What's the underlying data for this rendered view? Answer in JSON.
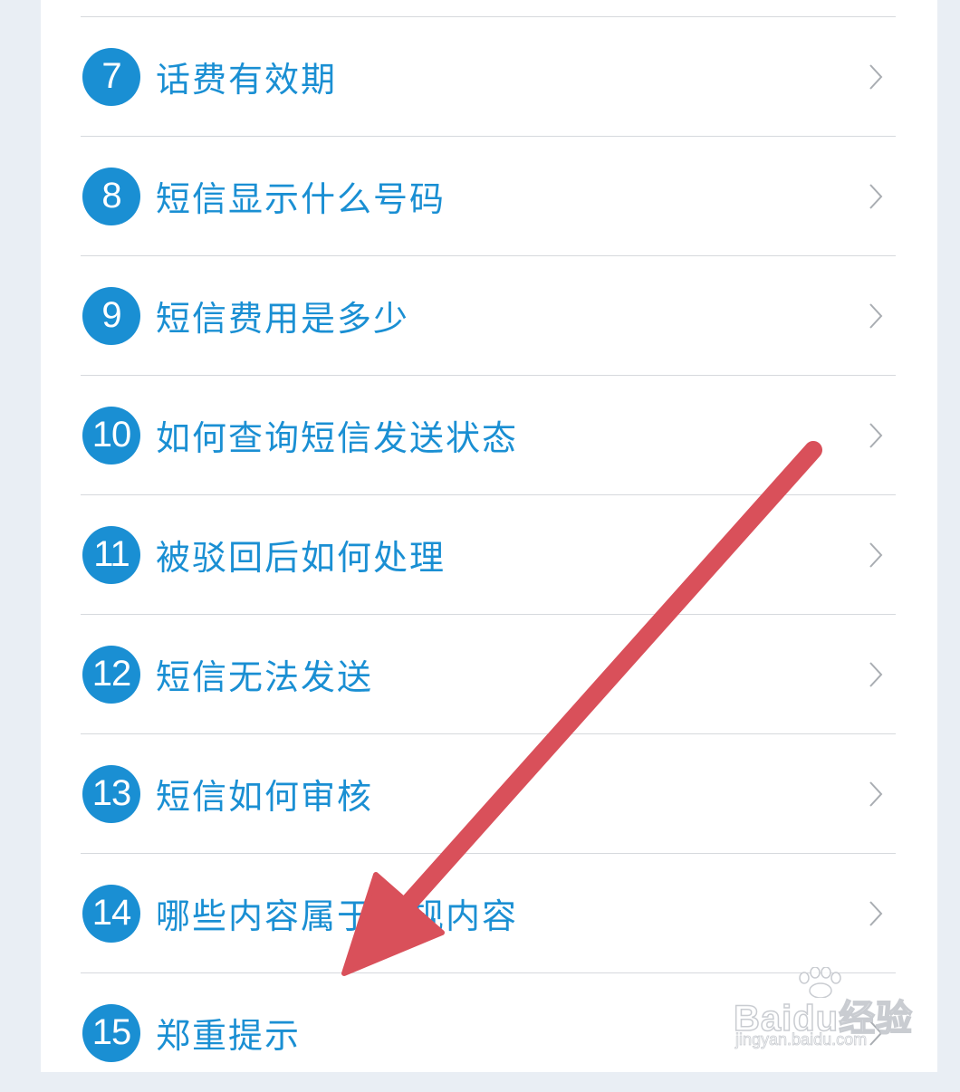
{
  "faq": {
    "items": [
      {
        "number": "7",
        "label": "话费有效期"
      },
      {
        "number": "8",
        "label": "短信显示什么号码"
      },
      {
        "number": "9",
        "label": "短信费用是多少"
      },
      {
        "number": "10",
        "label": "如何查询短信发送状态"
      },
      {
        "number": "11",
        "label": "被驳回后如何处理"
      },
      {
        "number": "12",
        "label": "短信无法发送"
      },
      {
        "number": "13",
        "label": "短信如何审核"
      },
      {
        "number": "14",
        "label": "哪些内容属于违规内容"
      },
      {
        "number": "15",
        "label": "郑重提示"
      }
    ]
  },
  "watermark": {
    "main": "Baidu经验",
    "sub": "jingyan.baidu.com"
  },
  "colors": {
    "accent": "#1a8fd3",
    "annotation_arrow": "#d9505a",
    "divider": "#d6d9dd"
  },
  "icons": {
    "chevron": "chevron-right-icon",
    "annotation": "red-arrow-annotation"
  }
}
